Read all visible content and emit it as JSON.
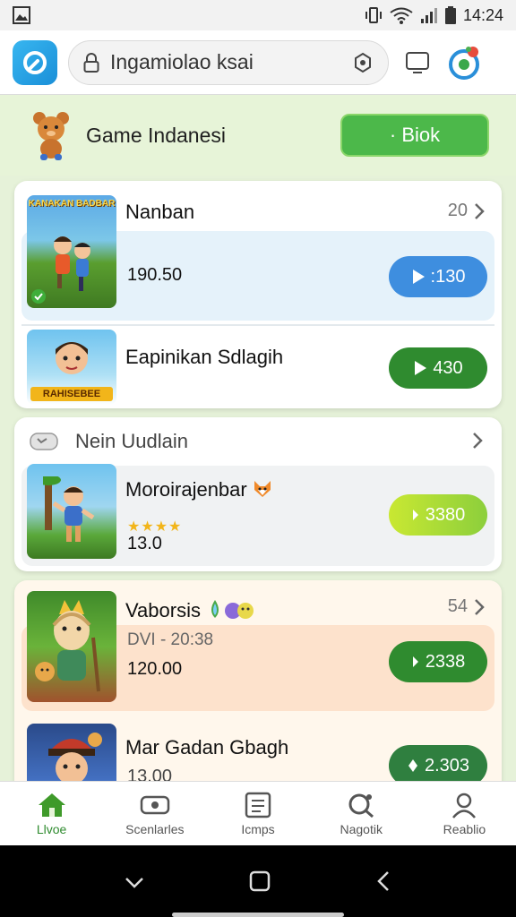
{
  "status": {
    "time": "14:24"
  },
  "browser": {
    "url": "Ingamiolao ksai"
  },
  "header": {
    "title": "Game Indanesi",
    "button_label": "· Biok"
  },
  "card1": {
    "row1": {
      "thumb_label": "KANAKAN BADBAR",
      "title": "Nanban",
      "meta": "20",
      "value": "190.50",
      "button": ":130"
    },
    "row2": {
      "thumb_label": "RAHISEBEE",
      "title": "Eapinikan Sdlagih",
      "button": "430"
    }
  },
  "card2": {
    "header": "Nein Uudlain",
    "row1": {
      "title": "Moroirajenbar",
      "stars": "★★★★",
      "value": "13.0",
      "button": "3380"
    }
  },
  "card3": {
    "row1": {
      "title": "Vaborsis",
      "meta": "54",
      "subtitle": "DVI - 20:38",
      "value": "120.00",
      "button": "2338"
    },
    "row2": {
      "title": "Mar Gadan Gbagh",
      "value": "13.00",
      "button": "2.303"
    }
  },
  "nav": {
    "items": [
      {
        "label": "Llvoe"
      },
      {
        "label": "Scenlarles"
      },
      {
        "label": "Icmps"
      },
      {
        "label": "Nagotik"
      },
      {
        "label": "Reablio"
      }
    ]
  },
  "colors": {
    "accent_green": "#4cb84a",
    "dark_green": "#2f8b2f",
    "blue_button": "#3e8edf",
    "lime_button": "#a9d93a",
    "header_bg": "#e7f4d8"
  }
}
